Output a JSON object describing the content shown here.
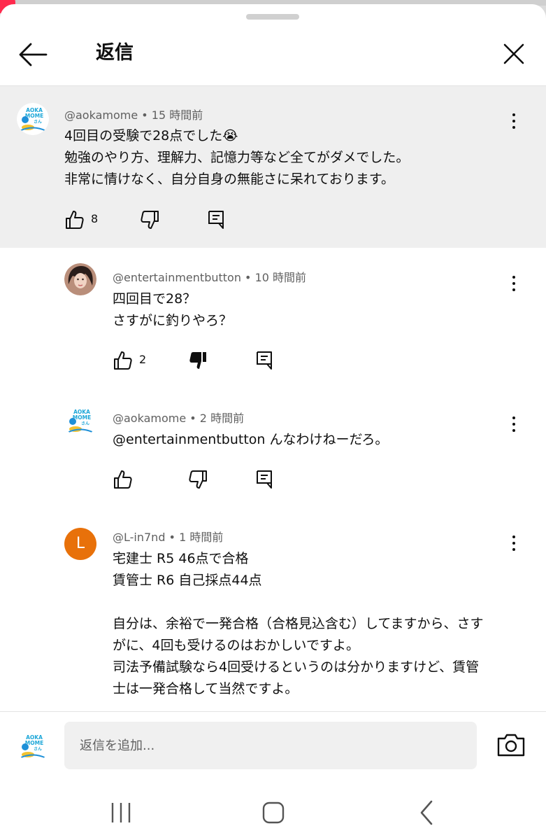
{
  "header": {
    "title": "返信"
  },
  "comments": [
    {
      "author": "@aokamome",
      "time": "15 時間前",
      "lines": [
        "4回目の受験で28点でした😭",
        "勉強のやり方、理解力、記憶力等など全てがダメでした。",
        "非常に情けなく、自分自身の無能さに呆れております。"
      ],
      "likes": "8",
      "disliked": false,
      "avatar_logo": [
        "AOKA",
        "MOME",
        "さん"
      ]
    },
    {
      "author": "@entertainmentbutton",
      "time": "10 時間前",
      "lines": [
        "四回目で28？",
        "さすがに釣りやろ？"
      ],
      "likes": "2",
      "disliked": true
    },
    {
      "author": "@aokamome",
      "time": "2 時間前",
      "lines": [
        "@entertainmentbutton  んなわけねーだろ。"
      ],
      "likes": "",
      "disliked": false,
      "avatar_logo": [
        "AOKA",
        "MOME",
        "さん"
      ]
    },
    {
      "author": "@L-in7nd",
      "time": "1 時間前",
      "avatar_letter": "L",
      "avatar_color": "#e8710a",
      "lines": [
        "宅建士 R5 46点で合格",
        "賃管士 R6 自己採点44点",
        "",
        "自分は、余裕で一発合格（合格見込含む）してますから、さす",
        "がに、4回も受けるのはおかしいですよ。",
        "司法予備試験なら4回受けるというのは分かりますけど、賃管",
        "士は一発合格して当然ですよ。"
      ],
      "likes": "",
      "disliked": false
    }
  ],
  "compose": {
    "placeholder": "返信を追加...",
    "avatar_logo": [
      "AOKA",
      "MOME",
      "さん"
    ]
  },
  "icons": {
    "back": "arrow-left-icon",
    "close": "close-icon",
    "more": "more-vert-icon",
    "like": "thumb-up-icon",
    "dislike": "thumb-down-icon",
    "reply": "reply-comment-icon",
    "camera": "camera-icon",
    "recents": "recents-icon",
    "home": "home-icon",
    "nav_back": "nav-back-icon"
  },
  "colors": {
    "meta_text": "#606060",
    "highlight_bg": "#efefef",
    "avatar_L": "#e8710a"
  }
}
